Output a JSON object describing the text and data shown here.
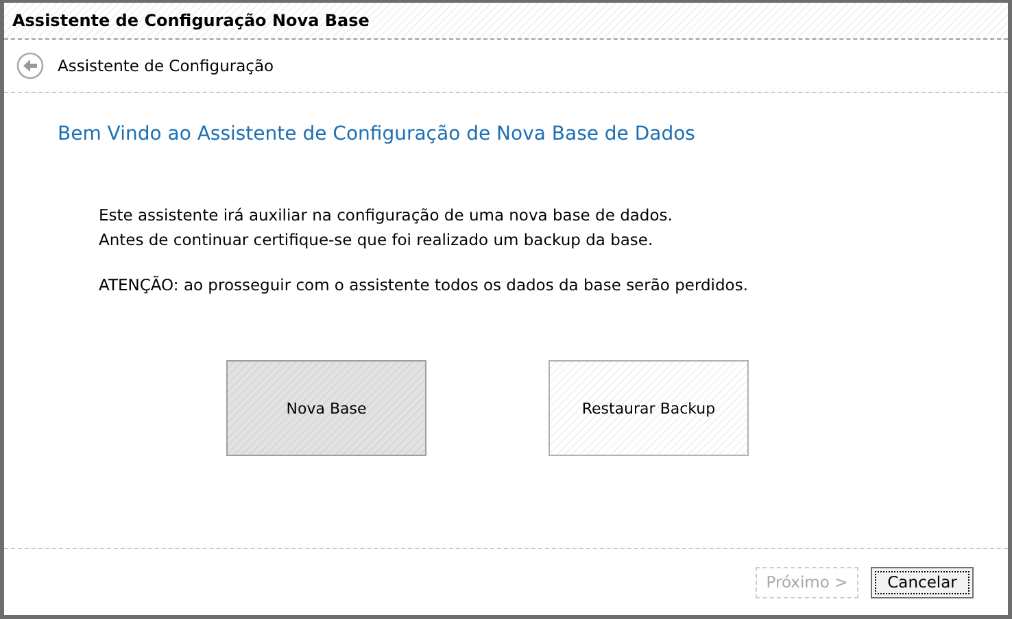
{
  "window": {
    "title": "Assistente de Configuração Nova Base"
  },
  "header": {
    "title": "Assistente de Configuração"
  },
  "heading": "Bem Vindo ao Assistente de Configuração de Nova Base de Dados",
  "paragraphs": [
    "Este assistente irá auxiliar na configuração de uma nova base de dados.\nAntes de continuar certifique-se que foi realizado um backup da base.",
    "ATENÇÃO: ao prosseguir com o assistente todos os dados da base serão perdidos."
  ],
  "options": [
    {
      "label": "Nova Base",
      "selected": true
    },
    {
      "label": "Restaurar Backup",
      "selected": false
    }
  ],
  "footer_buttons": [
    {
      "label": "Próximo >",
      "disabled": true,
      "focused": false
    },
    {
      "label": "Cancelar",
      "disabled": false,
      "focused": true
    }
  ]
}
